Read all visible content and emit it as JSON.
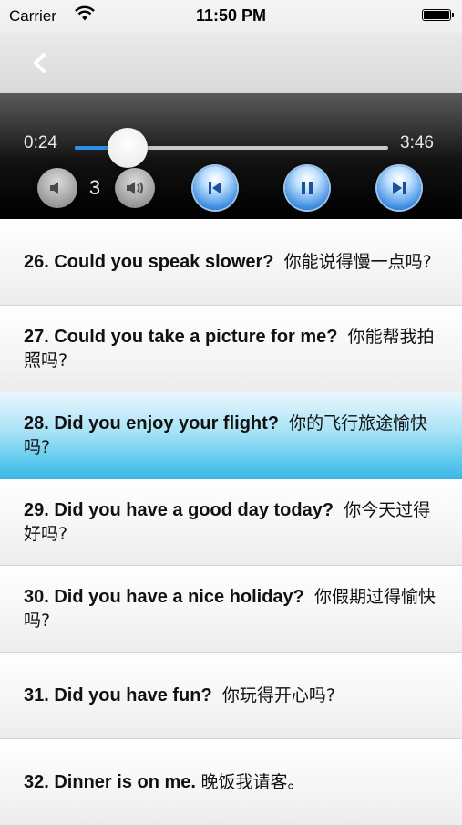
{
  "status_bar": {
    "carrier": "Carrier",
    "time": "11:50 PM"
  },
  "player": {
    "current_time": "0:24",
    "total_time": "3:46",
    "progress": 0.106,
    "speed": "3",
    "accent_color": "#2b8fe8"
  },
  "phrases": [
    {
      "en": "26. Could you speak slower?",
      "zh": "你能说得慢一点吗?",
      "selected": false
    },
    {
      "en": "27. Could you take a picture for me?",
      "zh": "你能帮我拍照吗?",
      "selected": false
    },
    {
      "en": "28. Did you enjoy your flight?",
      "zh": "你的飞行旅途愉快吗?",
      "selected": true
    },
    {
      "en": "29. Did you have a good day today?",
      "zh": "你今天过得好吗?",
      "selected": false
    },
    {
      "en": "30. Did you have a nice holiday?",
      "zh": "你假期过得愉快吗?",
      "selected": false
    },
    {
      "en": "31. Did you have fun?",
      "zh": "你玩得开心吗?",
      "selected": false
    },
    {
      "en": "32. Dinner is on me.",
      "zh": "晚饭我请客。",
      "selected": false
    }
  ],
  "icons": {
    "back": "chevron-left-icon",
    "volume_down": "speaker-low-icon",
    "volume_up": "speaker-high-icon",
    "previous": "skip-previous-icon",
    "pause": "pause-icon",
    "next": "skip-next-icon"
  }
}
